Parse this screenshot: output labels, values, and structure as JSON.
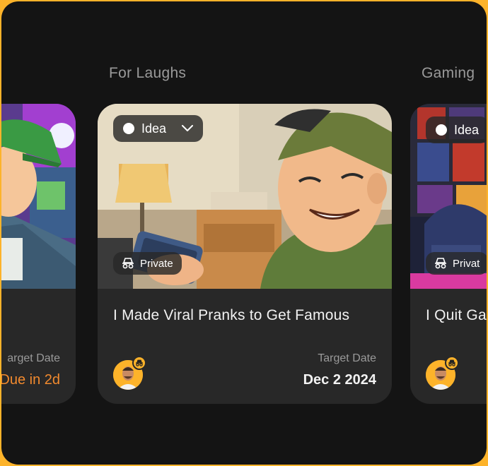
{
  "sections": [
    {
      "label": "For Laughs"
    },
    {
      "label": "Gaming"
    }
  ],
  "cards": [
    {
      "title": "",
      "target_date_label": "arget Date",
      "target_date_value": "Due in 2d",
      "value_color": "#f28a2e"
    },
    {
      "title": "I Made Viral Pranks to Get Famous",
      "status": "Idea",
      "visibility": "Private",
      "target_date_label": "Target Date",
      "target_date_value": "Dec 2 2024"
    },
    {
      "title": "I Quit Ga",
      "status": "Idea",
      "visibility": "Privat"
    }
  ],
  "icons": {
    "status_dropdown": "chevron-down-icon",
    "visibility": "incognito-icon",
    "status_indicator": "circle-icon"
  },
  "colors": {
    "frame_border": "#fdb32a",
    "background": "#141414",
    "card": "#282828",
    "due_accent": "#f28a2e"
  }
}
